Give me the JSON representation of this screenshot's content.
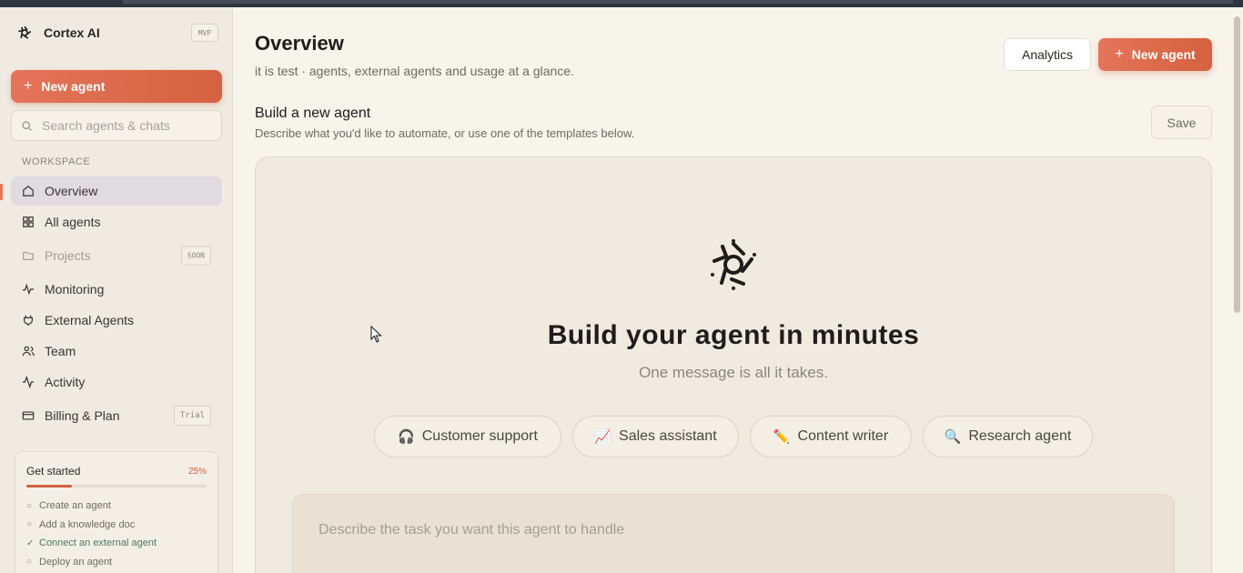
{
  "brand": {
    "name": "Cortex AI",
    "badge": "MVP"
  },
  "sidebar": {
    "new_agent_label": "New agent",
    "search_placeholder": "Search agents & chats",
    "section_label": "WORKSPACE",
    "items": [
      {
        "label": "Overview",
        "icon": "home-icon",
        "active": true
      },
      {
        "label": "All agents",
        "icon": "grid-icon"
      },
      {
        "label": "Projects",
        "icon": "folder-icon",
        "badge": "SOON",
        "disabled": true
      },
      {
        "label": "Monitoring",
        "icon": "pulse-icon"
      },
      {
        "label": "External Agents",
        "icon": "plug-icon"
      },
      {
        "label": "Team",
        "icon": "users-icon"
      },
      {
        "label": "Activity",
        "icon": "activity-icon"
      },
      {
        "label": "Billing & Plan",
        "icon": "card-icon",
        "badge": "Trial"
      }
    ],
    "get_started": {
      "title": "Get started",
      "percent_label": "25%",
      "progress": 0.25,
      "items": [
        {
          "label": "Create an agent",
          "done": false
        },
        {
          "label": "Add a knowledge doc",
          "done": false
        },
        {
          "label": "Connect an external agent",
          "done": true
        },
        {
          "label": "Deploy an agent",
          "done": false
        }
      ]
    }
  },
  "header": {
    "title": "Overview",
    "subtitle": "it is test · agents, external agents and usage at a glance.",
    "analytics_label": "Analytics",
    "new_agent_label": "New agent"
  },
  "builder": {
    "title": "Build a new agent",
    "subtitle": "Describe what you'd like to automate, or use one of the templates below.",
    "save_label": "Save",
    "hero_title": "Build your agent in minutes",
    "hero_subtitle": "One message is all it takes.",
    "templates": [
      {
        "label": "Customer support",
        "icon": "headphones-icon",
        "glyph": "🎧"
      },
      {
        "label": "Sales assistant",
        "icon": "chart-icon",
        "glyph": "📈"
      },
      {
        "label": "Content writer",
        "icon": "pencil-icon",
        "glyph": "✏️"
      },
      {
        "label": "Research agent",
        "icon": "magnifier-icon",
        "glyph": "🔍"
      }
    ],
    "task_placeholder": "Describe the task you want this agent to handle"
  },
  "colors": {
    "accent": "#d4623f",
    "background": "#f7f4ec",
    "sidebar": "#efebe2"
  }
}
